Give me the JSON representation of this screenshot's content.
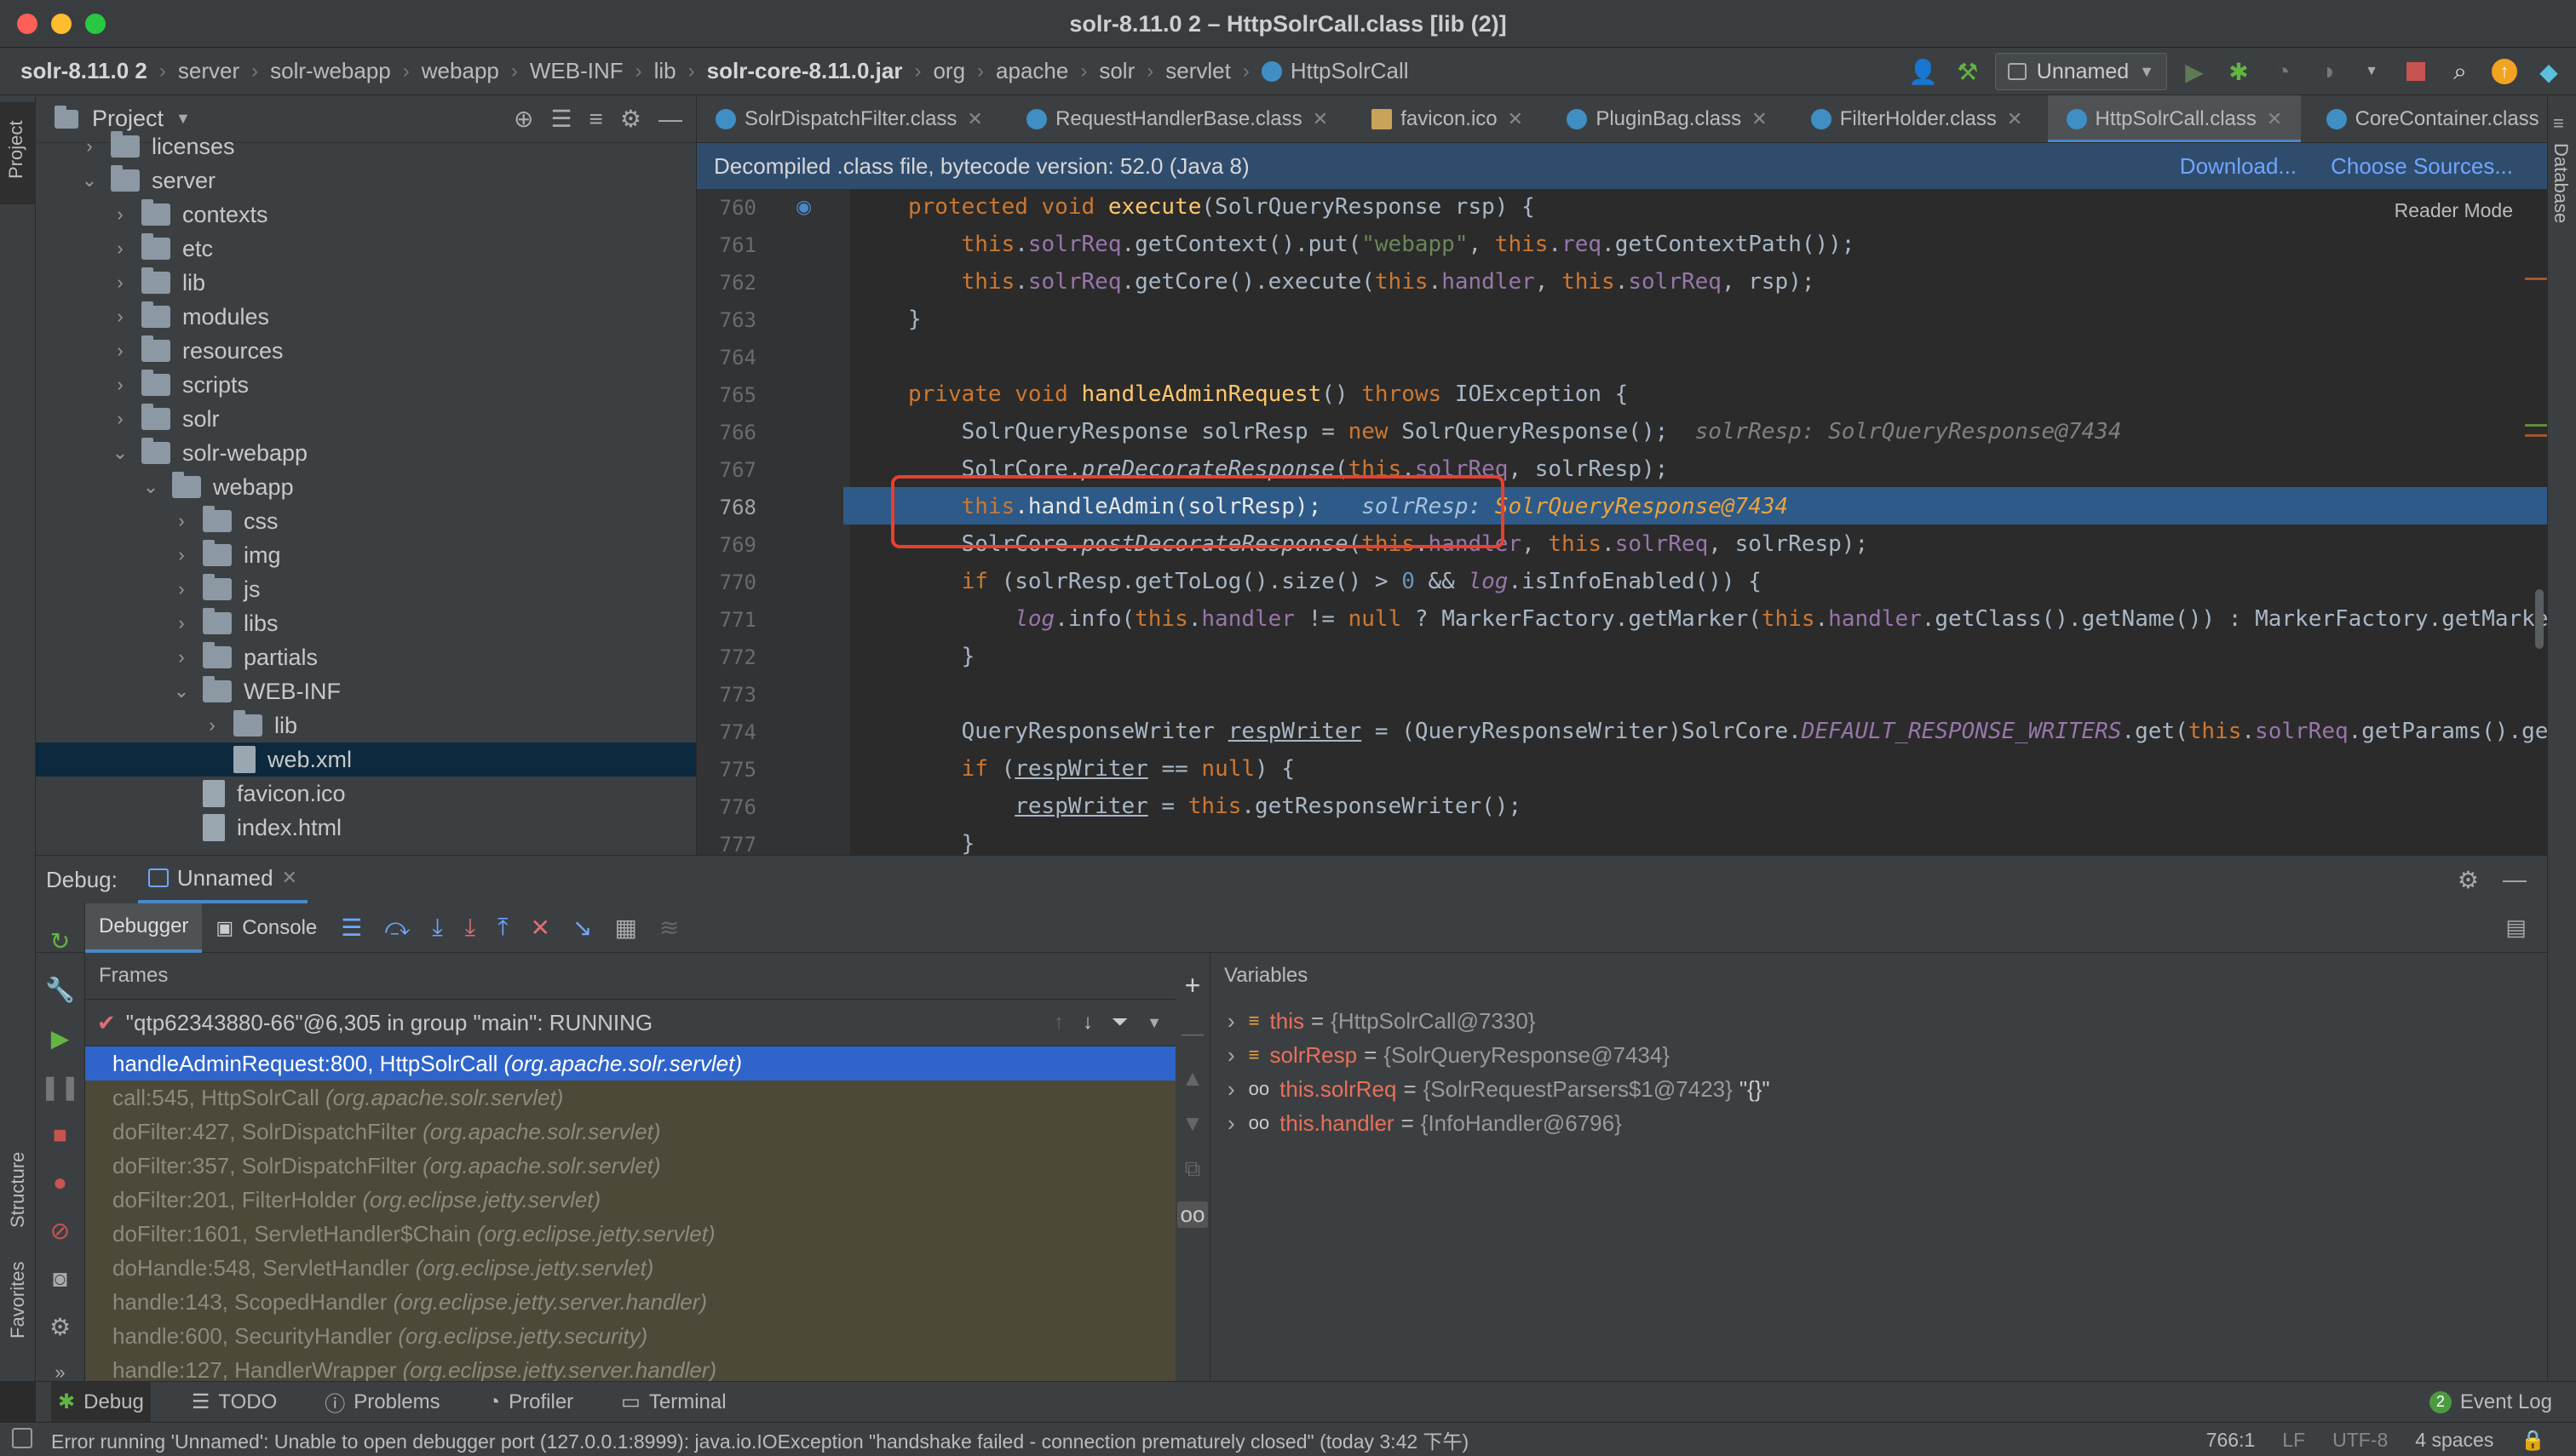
{
  "window": {
    "title": "solr-8.11.0 2 – HttpSolrCall.class [lib (2)]"
  },
  "breadcrumbs": [
    "solr-8.11.0 2",
    "server",
    "solr-webapp",
    "webapp",
    "WEB-INF",
    "lib",
    "solr-core-8.11.0.jar",
    "org",
    "apache",
    "solr",
    "servlet",
    "HttpSolrCall"
  ],
  "run_config": "Unnamed",
  "project": {
    "title": "Project",
    "tree": [
      {
        "label": "licenses",
        "depth": 1,
        "expanded": false
      },
      {
        "label": "server",
        "depth": 1,
        "expanded": true
      },
      {
        "label": "contexts",
        "depth": 2,
        "expanded": false
      },
      {
        "label": "etc",
        "depth": 2,
        "expanded": false
      },
      {
        "label": "lib",
        "depth": 2,
        "expanded": false
      },
      {
        "label": "modules",
        "depth": 2,
        "expanded": false
      },
      {
        "label": "resources",
        "depth": 2,
        "expanded": false
      },
      {
        "label": "scripts",
        "depth": 2,
        "expanded": false
      },
      {
        "label": "solr",
        "depth": 2,
        "expanded": false
      },
      {
        "label": "solr-webapp",
        "depth": 2,
        "expanded": true
      },
      {
        "label": "webapp",
        "depth": 3,
        "expanded": true
      },
      {
        "label": "css",
        "depth": 4,
        "expanded": false
      },
      {
        "label": "img",
        "depth": 4,
        "expanded": false
      },
      {
        "label": "js",
        "depth": 4,
        "expanded": false
      },
      {
        "label": "libs",
        "depth": 4,
        "expanded": false
      },
      {
        "label": "partials",
        "depth": 4,
        "expanded": false
      },
      {
        "label": "WEB-INF",
        "depth": 4,
        "expanded": true
      },
      {
        "label": "lib",
        "depth": 5,
        "expanded": false
      },
      {
        "label": "web.xml",
        "depth": 5,
        "file": true,
        "selected": true
      },
      {
        "label": "favicon.ico",
        "depth": 4,
        "file": true
      },
      {
        "label": "index.html",
        "depth": 4,
        "file": true
      }
    ]
  },
  "editor": {
    "tabs": [
      "SolrDispatchFilter.class",
      "RequestHandlerBase.class",
      "favicon.ico",
      "PluginBag.class",
      "FilterHolder.class",
      "HttpSolrCall.class",
      "CoreContainer.class"
    ],
    "active_tab": "HttpSolrCall.class",
    "infobar": "Decompiled .class file, bytecode version: 52.0 (Java 8)",
    "download": "Download...",
    "choose_sources": "Choose Sources...",
    "reader_mode": "Reader Mode",
    "line_numbers": [
      "760",
      "761",
      "762",
      "763",
      "764",
      "765",
      "766",
      "767",
      "768",
      "769",
      "770",
      "771",
      "772",
      "773",
      "774",
      "775",
      "776",
      "777"
    ],
    "current_line": "768"
  },
  "debug": {
    "label": "Debug:",
    "session": "Unnamed",
    "tab_debugger": "Debugger",
    "tab_console": "Console",
    "frames_header": "Frames",
    "variables_header": "Variables",
    "thread": "\"qtp62343880-66\"@6,305 in group \"main\": RUNNING",
    "frames": [
      {
        "method": "handleAdminRequest:800, HttpSolrCall",
        "pkg": "(org.apache.solr.servlet)"
      },
      {
        "method": "call:545, HttpSolrCall",
        "pkg": "(org.apache.solr.servlet)"
      },
      {
        "method": "doFilter:427, SolrDispatchFilter",
        "pkg": "(org.apache.solr.servlet)"
      },
      {
        "method": "doFilter:357, SolrDispatchFilter",
        "pkg": "(org.apache.solr.servlet)"
      },
      {
        "method": "doFilter:201, FilterHolder",
        "pkg": "(org.eclipse.jetty.servlet)"
      },
      {
        "method": "doFilter:1601, ServletHandler$Chain",
        "pkg": "(org.eclipse.jetty.servlet)"
      },
      {
        "method": "doHandle:548, ServletHandler",
        "pkg": "(org.eclipse.jetty.servlet)"
      },
      {
        "method": "handle:143, ScopedHandler",
        "pkg": "(org.eclipse.jetty.server.handler)"
      },
      {
        "method": "handle:600, SecurityHandler",
        "pkg": "(org.eclipse.jetty.security)"
      },
      {
        "method": "handle:127, HandlerWrapper",
        "pkg": "(org.eclipse.jetty.server.handler)"
      }
    ],
    "variables": [
      {
        "name": "this",
        "value": "{HttpSolrCall@7330}",
        "extra": ""
      },
      {
        "name": "solrResp",
        "value": "{SolrQueryResponse@7434}",
        "extra": ""
      },
      {
        "name": "this.solrReq",
        "value": "{SolrRequestParsers$1@7423}",
        "extra": "\"{}\""
      },
      {
        "name": "this.handler",
        "value": "{InfoHandler@6796}",
        "extra": ""
      }
    ]
  },
  "toolwindows": [
    "Debug",
    "TODO",
    "Problems",
    "Profiler",
    "Terminal"
  ],
  "event_log": "Event Log",
  "event_log_count": "2",
  "side_labels": {
    "project": "Project",
    "structure": "Structure",
    "favorites": "Favorites",
    "database": "Database"
  },
  "status": {
    "message": "Error running 'Unnamed': Unable to open debugger port (127.0.0.1:8999): java.io.IOException \"handshake failed - connection prematurely closed\" (today 3:42 下午)",
    "position": "766:1",
    "line_sep": "LF",
    "encoding": "UTF-8",
    "indent": "4 spaces"
  }
}
